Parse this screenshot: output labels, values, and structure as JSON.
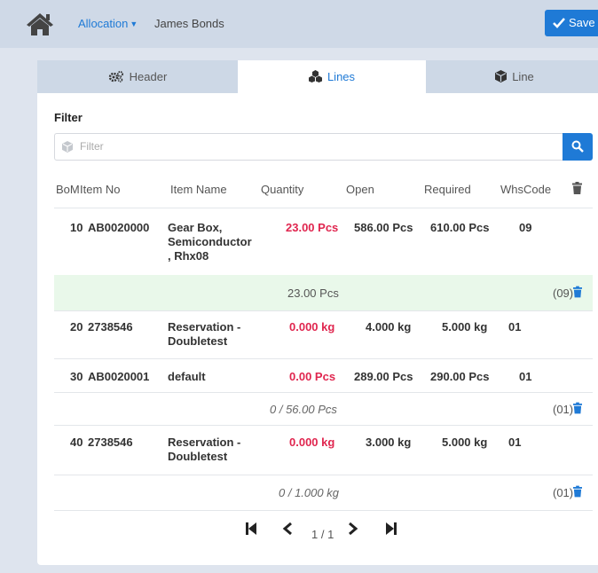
{
  "breadcrumb": {
    "link": "Allocation",
    "name": "James Bonds"
  },
  "actions": {
    "save": "Save"
  },
  "tabs": {
    "header": "Header",
    "lines": "Lines",
    "line": "Line"
  },
  "filter": {
    "title": "Filter",
    "placeholder": "Filter"
  },
  "columns": {
    "bom": "BoM",
    "item_no": "Item No",
    "item_name": "Item Name",
    "quantity": "Quantity",
    "open": "Open",
    "required": "Required",
    "whscode": "WhsCode"
  },
  "rows": [
    {
      "bom": "10",
      "item_no": "AB0020000",
      "item_name_lines": [
        "Gear Box,",
        "Semiconductor",
        ", Rhx08"
      ],
      "quantity": "23.00 Pcs",
      "open": "586.00 Pcs",
      "required": "610.00 Pcs",
      "whscode": "09",
      "sub": {
        "quantity": "23.00 Pcs",
        "whs": "(09)"
      }
    },
    {
      "bom": "20",
      "item_no": "2738546",
      "item_name_lines": [
        "Reservation -",
        "Doubletest"
      ],
      "quantity": "0.000 kg",
      "open": "4.000 kg",
      "required": "5.000 kg",
      "whscode": "01"
    },
    {
      "bom": "30",
      "item_no": "AB0020001",
      "item_name_lines": [
        "default"
      ],
      "quantity": "0.00 Pcs",
      "open": "289.00 Pcs",
      "required": "290.00 Pcs",
      "whscode": "01",
      "sub": {
        "quantity": "0 / 56.00 Pcs",
        "whs": "(01)"
      }
    },
    {
      "bom": "40",
      "item_no": "2738546",
      "item_name_lines": [
        "Reservation -",
        "Doubletest"
      ],
      "quantity": "0.000 kg",
      "open": "3.000 kg",
      "required": "5.000 kg",
      "whscode": "01",
      "sub": {
        "quantity": "0 / 1.000 kg",
        "whs": "(01)"
      }
    }
  ],
  "pager": {
    "text": "1 / 1"
  },
  "colors": {
    "accent": "#1f7ad6",
    "negative": "#e0264f",
    "highlight_row": "#e9f8ea"
  }
}
